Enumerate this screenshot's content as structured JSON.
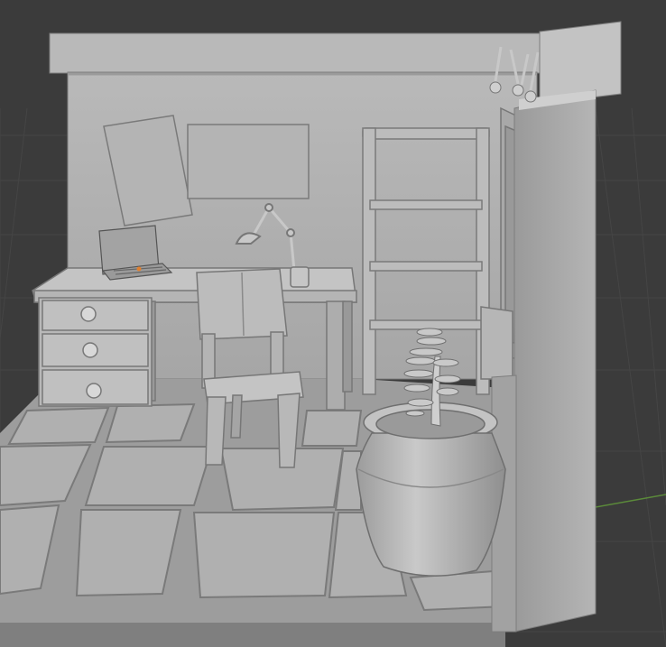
{
  "viewport": {
    "background_color": "#3b3b3b",
    "grid_color": "#454545",
    "axis_green_color": "#5b8a3a",
    "axis_red_color": "#8a3a3a"
  },
  "scene": {
    "subject": "3d-room-diorama",
    "material_color": "#b3b3b3",
    "shadow_color": "#8c8c8c",
    "highlight_color": "#d4d4d4",
    "objects": [
      "back-wall",
      "right-wall",
      "floor-tiles",
      "desk",
      "drawers",
      "laptop",
      "desk-lamp",
      "pen-cup",
      "chair",
      "bookshelf",
      "window",
      "wall-hooks",
      "posters",
      "plant-pot",
      "plant"
    ]
  }
}
